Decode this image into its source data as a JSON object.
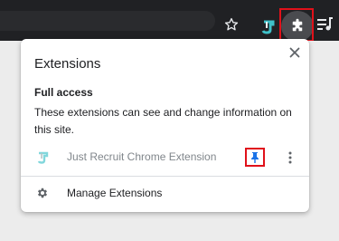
{
  "toolbar": {
    "icons": [
      "star-icon",
      "just-recruit-icon",
      "puzzle-piece-icon",
      "media-queue-icon"
    ]
  },
  "extensions_panel": {
    "title": "Extensions",
    "section_heading": "Full access",
    "section_description": "These extensions can see and change information on this site.",
    "extension_name": "Just Recruit Chrome Extension",
    "manage_label": "Manage Extensions"
  },
  "colors": {
    "toolbar_bg": "#202124",
    "highlight": "#e0111a",
    "pin_blue": "#1a73e8",
    "logo_teal": "#3fc1c9"
  }
}
